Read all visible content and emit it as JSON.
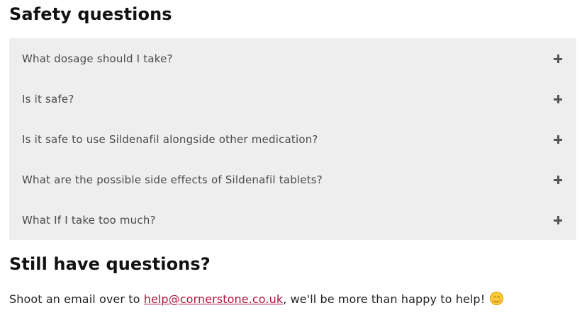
{
  "safety": {
    "heading": "Safety questions",
    "items": [
      {
        "question": "What dosage should I take?",
        "icon": "plus-icon"
      },
      {
        "question": "Is it safe?",
        "icon": "plus-icon"
      },
      {
        "question": "Is it safe to use Sildenafil alongside other medication?",
        "icon": "plus-icon"
      },
      {
        "question": "What are the possible side effects of Sildenafil tablets?",
        "icon": "plus-icon"
      },
      {
        "question": "What If I take too much?",
        "icon": "plus-icon"
      }
    ]
  },
  "contact": {
    "heading": "Still have questions?",
    "text_before": "Shoot an email over to ",
    "email": "help@cornerstone.co.uk",
    "text_after": ", we'll be more than happy to help! ",
    "emoji": "smiling-face-icon"
  },
  "colors": {
    "accordion_background": "#eeeeee",
    "link": "#b0123d",
    "question_text": "#4a4a4a"
  }
}
